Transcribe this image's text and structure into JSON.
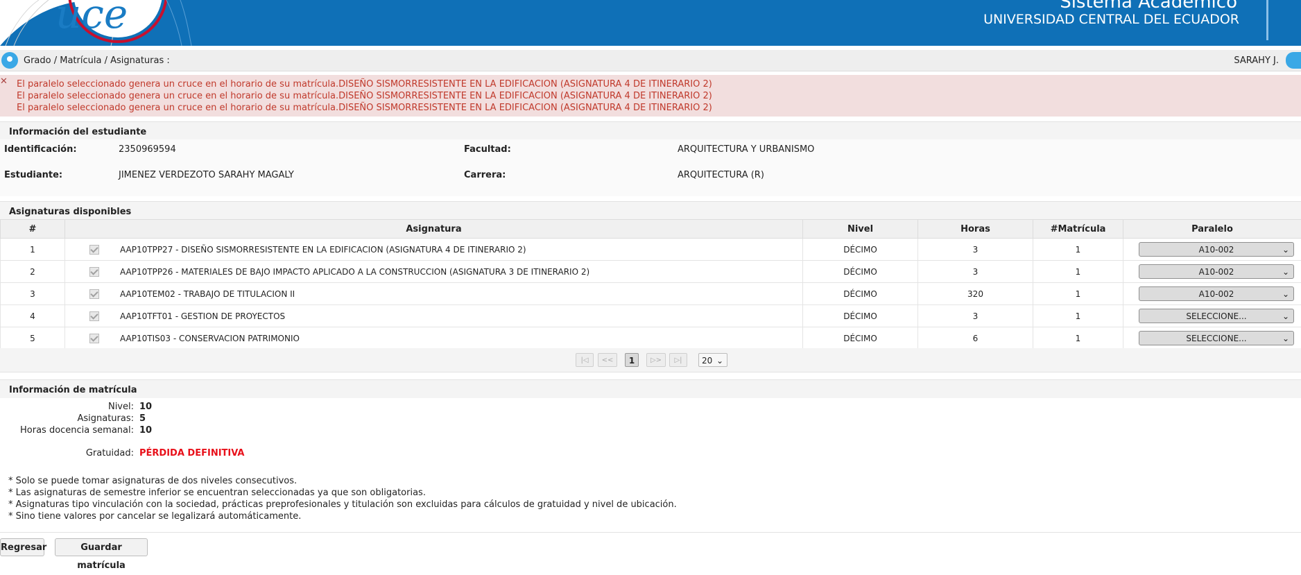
{
  "header": {
    "title": "Sistema Académico",
    "subtitle": "UNIVERSIDAD CENTRAL DEL ECUADOR",
    "logo_text": "uce",
    "brand_color": "#0f70b7"
  },
  "breadcrumb": {
    "path": "Grado / Matrícula / Asignaturas :",
    "user": "SARAHY J."
  },
  "alerts": [
    "El paralelo seleccionado genera un cruce en el horario de su matrícula.DISEÑO SISMORRESISTENTE EN LA EDIFICACION (ASIGNATURA 4 DE ITINERARIO 2)",
    "El paralelo seleccionado genera un cruce en el horario de su matrícula.DISEÑO SISMORRESISTENTE EN LA EDIFICACION (ASIGNATURA 4 DE ITINERARIO 2)",
    "El paralelo seleccionado genera un cruce en el horario de su matrícula.DISEÑO SISMORRESISTENTE EN LA EDIFICACION (ASIGNATURA 4 DE ITINERARIO 2)"
  ],
  "student": {
    "section_title": "Información del estudiante",
    "id_label": "Identificación:",
    "id_value": "2350969594",
    "name_label": "Estudiante:",
    "name_value": "JIMENEZ VERDEZOTO SARAHY MAGALY",
    "faculty_label": "Facultad:",
    "faculty_value": "ARQUITECTURA Y URBANISMO",
    "career_label": "Carrera:",
    "career_value": "ARQUITECTURA (R)"
  },
  "subjects": {
    "section_title": "Asignaturas disponibles",
    "columns": [
      "#",
      "Asignatura",
      "Nivel",
      "Horas",
      "#Matrícula",
      "Paralelo"
    ],
    "rows": [
      {
        "num": "1",
        "subject": "AAP10TPP27 - DISEÑO SISMORRESISTENTE EN LA EDIFICACION (ASIGNATURA 4 DE ITINERARIO 2)",
        "level": "DÉCIMO",
        "hours": "3",
        "enrollment": "1",
        "parallel": "A10-002"
      },
      {
        "num": "2",
        "subject": "AAP10TPP26 - MATERIALES DE BAJO IMPACTO APLICADO A LA CONSTRUCCION (ASIGNATURA 3 DE ITINERARIO 2)",
        "level": "DÉCIMO",
        "hours": "3",
        "enrollment": "1",
        "parallel": "A10-002"
      },
      {
        "num": "3",
        "subject": "AAP10TEM02 - TRABAJO DE TITULACION II",
        "level": "DÉCIMO",
        "hours": "320",
        "enrollment": "1",
        "parallel": "A10-002"
      },
      {
        "num": "4",
        "subject": "AAP10TFT01 - GESTION DE PROYECTOS",
        "level": "DÉCIMO",
        "hours": "3",
        "enrollment": "1",
        "parallel": "SELECCIONE..."
      },
      {
        "num": "5",
        "subject": "AAP10TIS03 - CONSERVACION PATRIMONIO",
        "level": "DÉCIMO",
        "hours": "6",
        "enrollment": "1",
        "parallel": "SELECCIONE..."
      }
    ]
  },
  "pager": {
    "first": "|◁",
    "prev": "<<",
    "current": "1",
    "next": "▷>",
    "last": "▷|",
    "page_size": "20"
  },
  "enrollment": {
    "section_title": "Información de matrícula",
    "level_label": "Nivel:",
    "level_value": "10",
    "subjects_label": "Asignaturas:",
    "subjects_value": "5",
    "hours_label": "Horas docencia semanal:",
    "hours_value": "10",
    "gratuity_label": "Gratuidad:",
    "gratuity_value": "PÉRDIDA DEFINITIVA",
    "gratuity_color": "#e8101a"
  },
  "notes": [
    "* Solo se puede tomar asignaturas de dos niveles consecutivos.",
    "* Las asignaturas de semestre inferior se encuentran seleccionadas ya que son obligatorias.",
    "* Asignaturas tipo vinculación con la sociedad, prácticas preprofesionales y titulación son excluidas para cálculos de gratuidad y nivel de ubicación.",
    "* Sino tiene valores por cancelar se legalizará automáticamente."
  ],
  "actions": {
    "back_label": "Regresar",
    "save_label": "Guardar matrícula"
  }
}
